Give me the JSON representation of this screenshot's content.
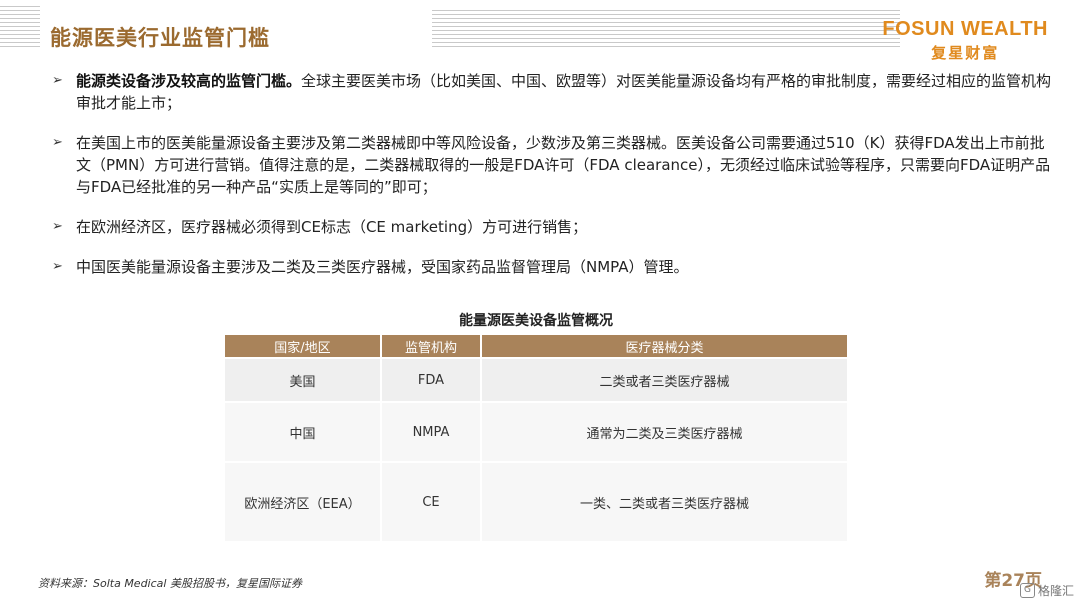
{
  "header": {
    "title": "能源医美行业监管门槛",
    "logo_en": "FOSUN WEALTH",
    "logo_cn": "复星财富"
  },
  "bullets": [
    {
      "bold": "能源类设备涉及较高的监管门槛。",
      "text": "全球主要医美市场（比如美国、中国、欧盟等）对医美能量源设备均有严格的审批制度，需要经过相应的监管机构审批才能上市；"
    },
    {
      "bold": "",
      "text": "在美国上市的医美能量源设备主要涉及第二类器械即中等风险设备，少数涉及第三类器械。医美设备公司需要通过510（K）获得FDA发出上市前批文（PMN）方可进行营销。值得注意的是，二类器械取得的一般是FDA许可（FDA clearance），无须经过临床试验等程序，只需要向FDA证明产品与FDA已经批准的另一种产品“实质上是等同的”即可；"
    },
    {
      "bold": "",
      "text": "在欧洲经济区，医疗器械必须得到CE标志（CE marketing）方可进行销售；"
    },
    {
      "bold": "",
      "text": "中国医美能量源设备主要涉及二类及三类医疗器械，受国家药品监督管理局（NMPA）管理。"
    }
  ],
  "table": {
    "title": "能量源医美设备监管概况",
    "headers": [
      "国家/地区",
      "监管机构",
      "医疗器械分类"
    ],
    "rows": [
      [
        "美国",
        "FDA",
        "二类或者三类医疗器械"
      ],
      [
        "中国",
        "NMPA",
        "通常为二类及三类医疗器械"
      ],
      [
        "欧洲经济区（EEA）",
        "CE",
        "一类、二类或者三类医疗器械"
      ]
    ]
  },
  "footer": {
    "source": "资料来源：Solta Medical 美股招股书，复星国际证券",
    "page": "第27页",
    "watermark": "格隆汇"
  },
  "icons": {
    "bullet": "arrow-bullet-icon",
    "watermark": "gelonghui-logo-icon"
  }
}
